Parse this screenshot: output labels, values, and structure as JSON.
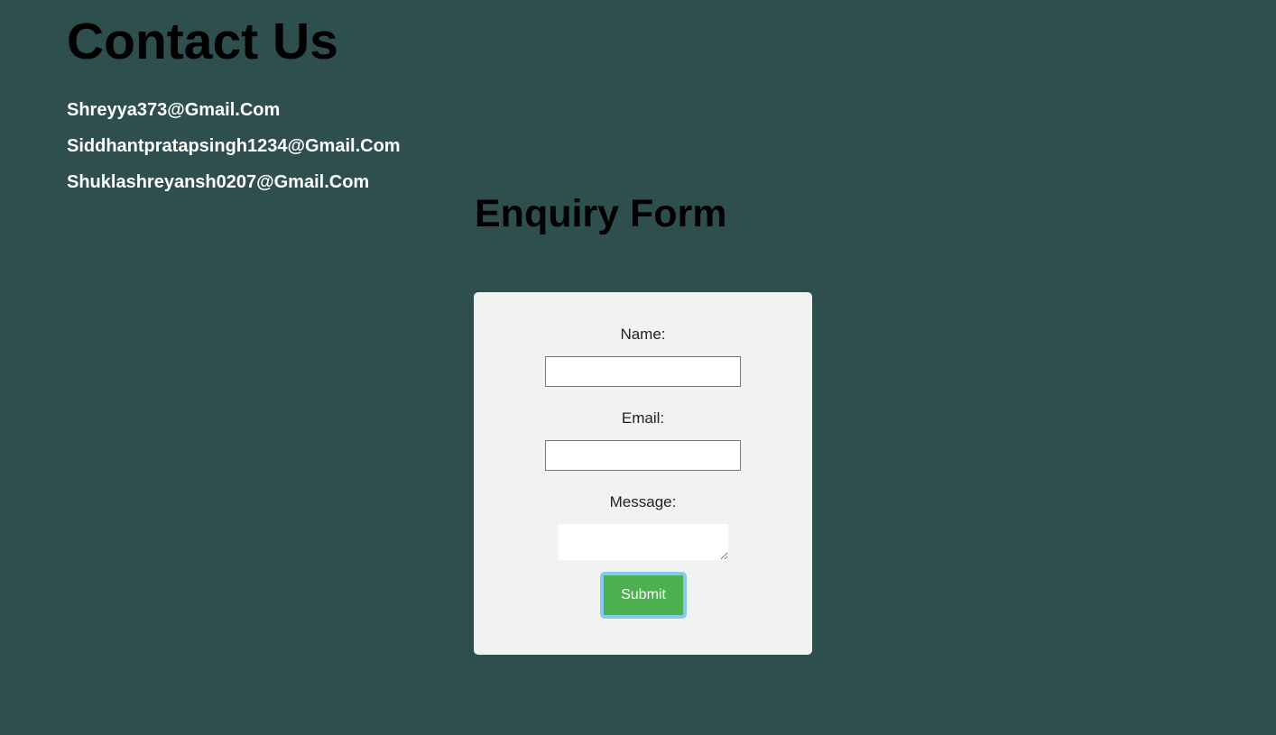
{
  "contact": {
    "title": "Contact Us",
    "emails": [
      "Shreyya373@Gmail.Com",
      "Siddhantpratapsingh1234@Gmail.Com",
      "Shuklashreyansh0207@Gmail.Com"
    ]
  },
  "enquiry_form": {
    "title": "Enquiry Form",
    "name_label": "Name:",
    "name_value": "",
    "email_label": "Email:",
    "email_value": "",
    "message_label": "Message:",
    "message_value": "",
    "submit_label": "Submit"
  },
  "colors": {
    "page_background": "#2f4f4f",
    "card_background": "#f2f2f2",
    "submit_background": "#4caf50",
    "submit_focus_ring": "#86c9ef"
  }
}
